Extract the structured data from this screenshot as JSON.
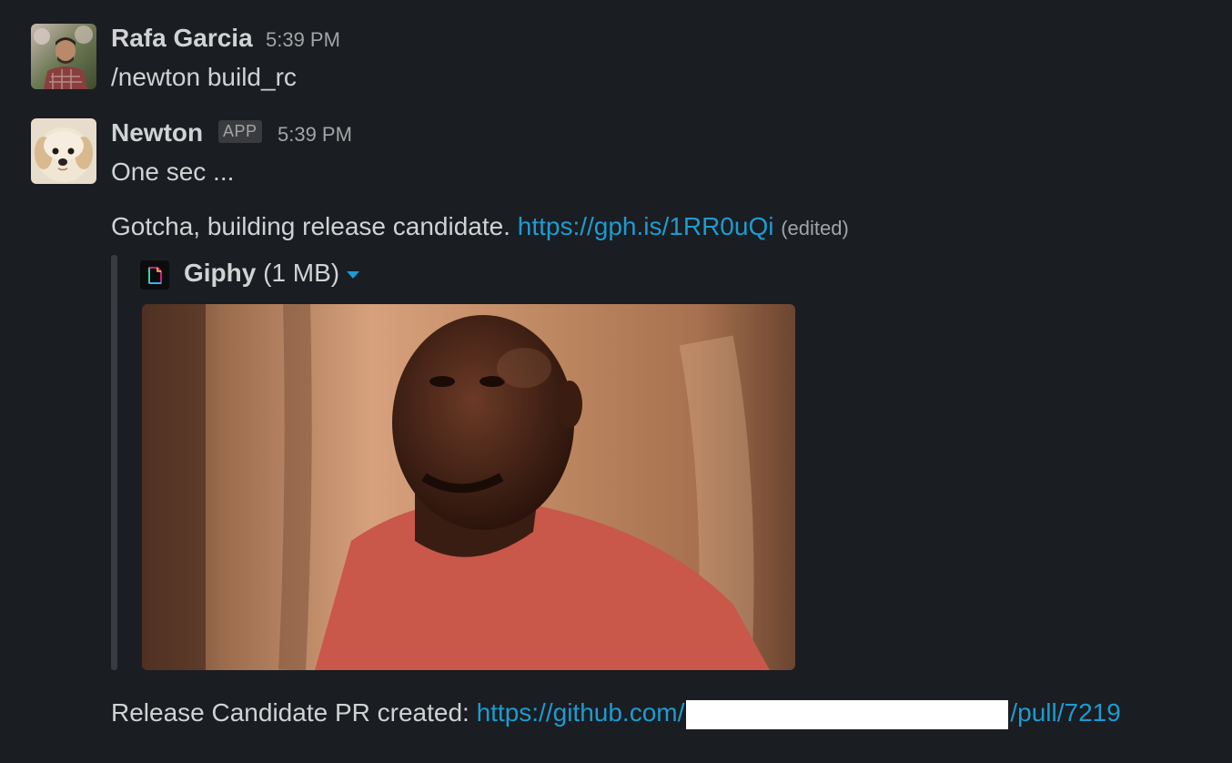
{
  "messages": [
    {
      "author": "Rafa Garcia",
      "time": "5:39 PM",
      "text": "/newton build_rc"
    },
    {
      "author": "Newton",
      "badge": "APP",
      "time": "5:39 PM",
      "text": "One sec ..."
    }
  ],
  "followup": {
    "text": "Gotcha, building release candidate. ",
    "link": "https://gph.is/1RR0uQi",
    "edited": "(edited)"
  },
  "attachment": {
    "name": "Giphy",
    "size": "(1 MB)",
    "icon": "file-icon"
  },
  "final": {
    "text": "Release Candidate PR created: ",
    "link_prefix": "https://github.com/",
    "link_suffix": "/pull/7219"
  },
  "colors": {
    "background": "#1a1d21",
    "link": "#1d9bd1",
    "text": "#d1d2d3",
    "muted": "#a3a4a6"
  }
}
